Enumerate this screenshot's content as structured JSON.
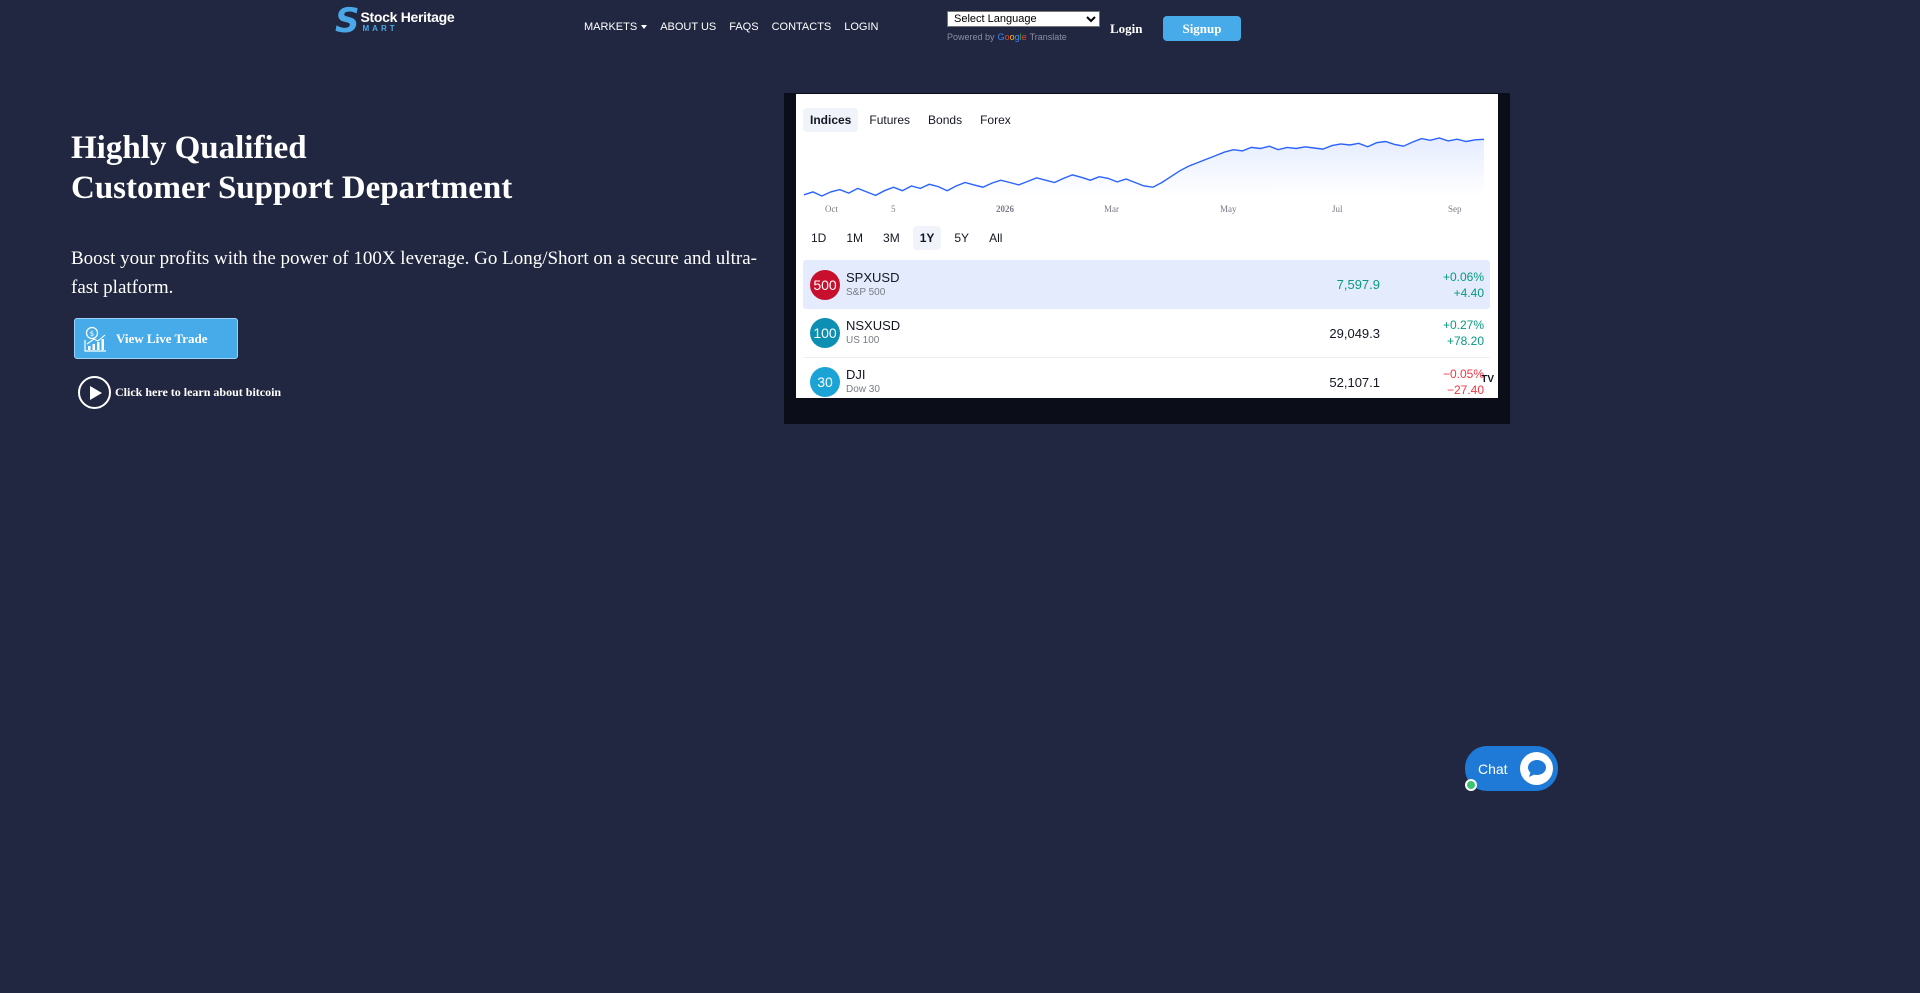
{
  "brand": {
    "logo_main": "Stock Heritage",
    "logo_sub": "MART",
    "logo_letter": "S"
  },
  "nav": {
    "items": [
      "MARKETS",
      "ABOUT US",
      "FAQS",
      "CONTACTS",
      "LOGIN"
    ]
  },
  "translate": {
    "select_label": "Select Language",
    "powered_by": "Powered by",
    "google": "Google",
    "translate": "Translate"
  },
  "header": {
    "login_label": "Login",
    "signup_label": "Signup"
  },
  "hero": {
    "title_line1": "Highly Qualified",
    "title_line2": "Customer Support Department",
    "description": "Boost your profits with the power of 100X leverage. Go Long/Short on a secure and ultra-fast platform.",
    "live_trade_label": "View Live Trade",
    "bitcoin_label": "Click here to learn about bitcoin"
  },
  "widget": {
    "tabs": [
      "Indices",
      "Futures",
      "Bonds",
      "Forex"
    ],
    "active_tab": "Indices",
    "ranges": [
      "1D",
      "1M",
      "3M",
      "1Y",
      "5Y",
      "All"
    ],
    "active_range": "1Y",
    "tv_logo": "TV",
    "rows": [
      {
        "badge": "500",
        "badge_color": "#c8102e",
        "symbol": "SPXUSD",
        "desc": "S&P 500",
        "price": "7,597.9",
        "pct": "+0.06%",
        "abs": "+4.40",
        "dir": "up",
        "selected": true
      },
      {
        "badge": "100",
        "badge_color": "#0c8fb3",
        "symbol": "NSXUSD",
        "desc": "US 100",
        "price": "29,049.3",
        "pct": "+0.27%",
        "abs": "+78.20",
        "dir": "up",
        "selected": false
      },
      {
        "badge": "30",
        "badge_color": "#1aa3d4",
        "symbol": "DJI",
        "desc": "Dow 30",
        "price": "52,107.1",
        "pct": "−0.05%",
        "abs": "−27.40",
        "dir": "down",
        "selected": false
      }
    ]
  },
  "chart_data": {
    "type": "area",
    "x_ticks": [
      "Oct",
      "5",
      "2026",
      "Mar",
      "May",
      "Jul",
      "Sep"
    ],
    "series": [
      {
        "values": [
          6650,
          6700,
          6630,
          6700,
          6740,
          6680,
          6760,
          6700,
          6640,
          6720,
          6780,
          6720,
          6800,
          6760,
          6830,
          6790,
          6720,
          6800,
          6860,
          6820,
          6780,
          6850,
          6900,
          6860,
          6820,
          6880,
          6940,
          6900,
          6860,
          6930,
          6990,
          6950,
          6900,
          6960,
          6930,
          6870,
          6920,
          6860,
          6800,
          6780,
          6860,
          6960,
          7060,
          7140,
          7200,
          7260,
          7320,
          7380,
          7420,
          7400,
          7460,
          7440,
          7480,
          7420,
          7460,
          7440,
          7470,
          7450,
          7430,
          7490,
          7520,
          7500,
          7530,
          7470,
          7540,
          7560,
          7510,
          7480,
          7550,
          7610,
          7580,
          7620,
          7570,
          7600,
          7560,
          7590,
          7598
        ]
      }
    ],
    "line_color": "#2962ff"
  },
  "chat": {
    "label": "Chat"
  }
}
